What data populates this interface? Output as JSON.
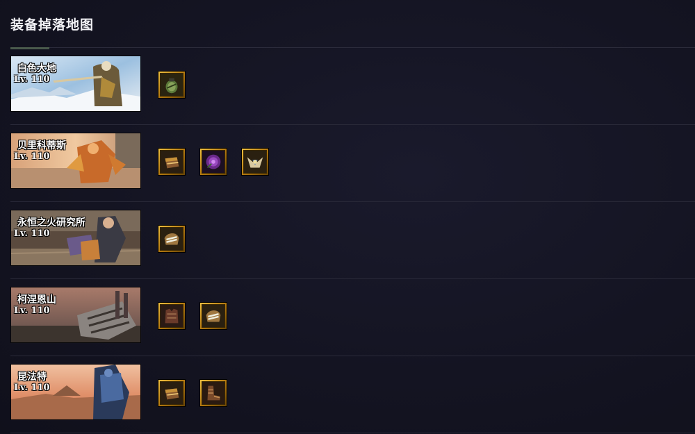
{
  "page": {
    "title": "装备掉落地图"
  },
  "maps": [
    {
      "name": "白色大地",
      "level": "Lv. 110",
      "art": "white-land-art",
      "items": [
        {
          "icon": "herb-pouch-icon",
          "rarity": "legendary"
        }
      ]
    },
    {
      "name": "贝里科蒂斯",
      "level": "Lv. 110",
      "art": "vericotis-art",
      "items": [
        {
          "icon": "gauntlet-icon",
          "rarity": "legendary"
        },
        {
          "icon": "purple-rose-icon",
          "rarity": "legendary"
        },
        {
          "icon": "winged-crest-icon",
          "rarity": "legendary"
        }
      ]
    },
    {
      "name": "永恒之火研究所",
      "level": "Lv. 110",
      "art": "eternal-fire-lab-art",
      "items": [
        {
          "icon": "fist-wrap-icon",
          "rarity": "legendary"
        }
      ]
    },
    {
      "name": "柯涅恩山",
      "level": "Lv. 110",
      "art": "mount-koneen-art",
      "items": [
        {
          "icon": "leather-armor-icon",
          "rarity": "legendary"
        },
        {
          "icon": "fist-wrap-icon",
          "rarity": "legendary"
        }
      ]
    },
    {
      "name": "昆法特",
      "level": "Lv. 110",
      "art": "kunfat-art",
      "items": [
        {
          "icon": "gauntlet-icon",
          "rarity": "legendary"
        },
        {
          "icon": "leather-boots-icon",
          "rarity": "legendary"
        }
      ]
    }
  ]
}
